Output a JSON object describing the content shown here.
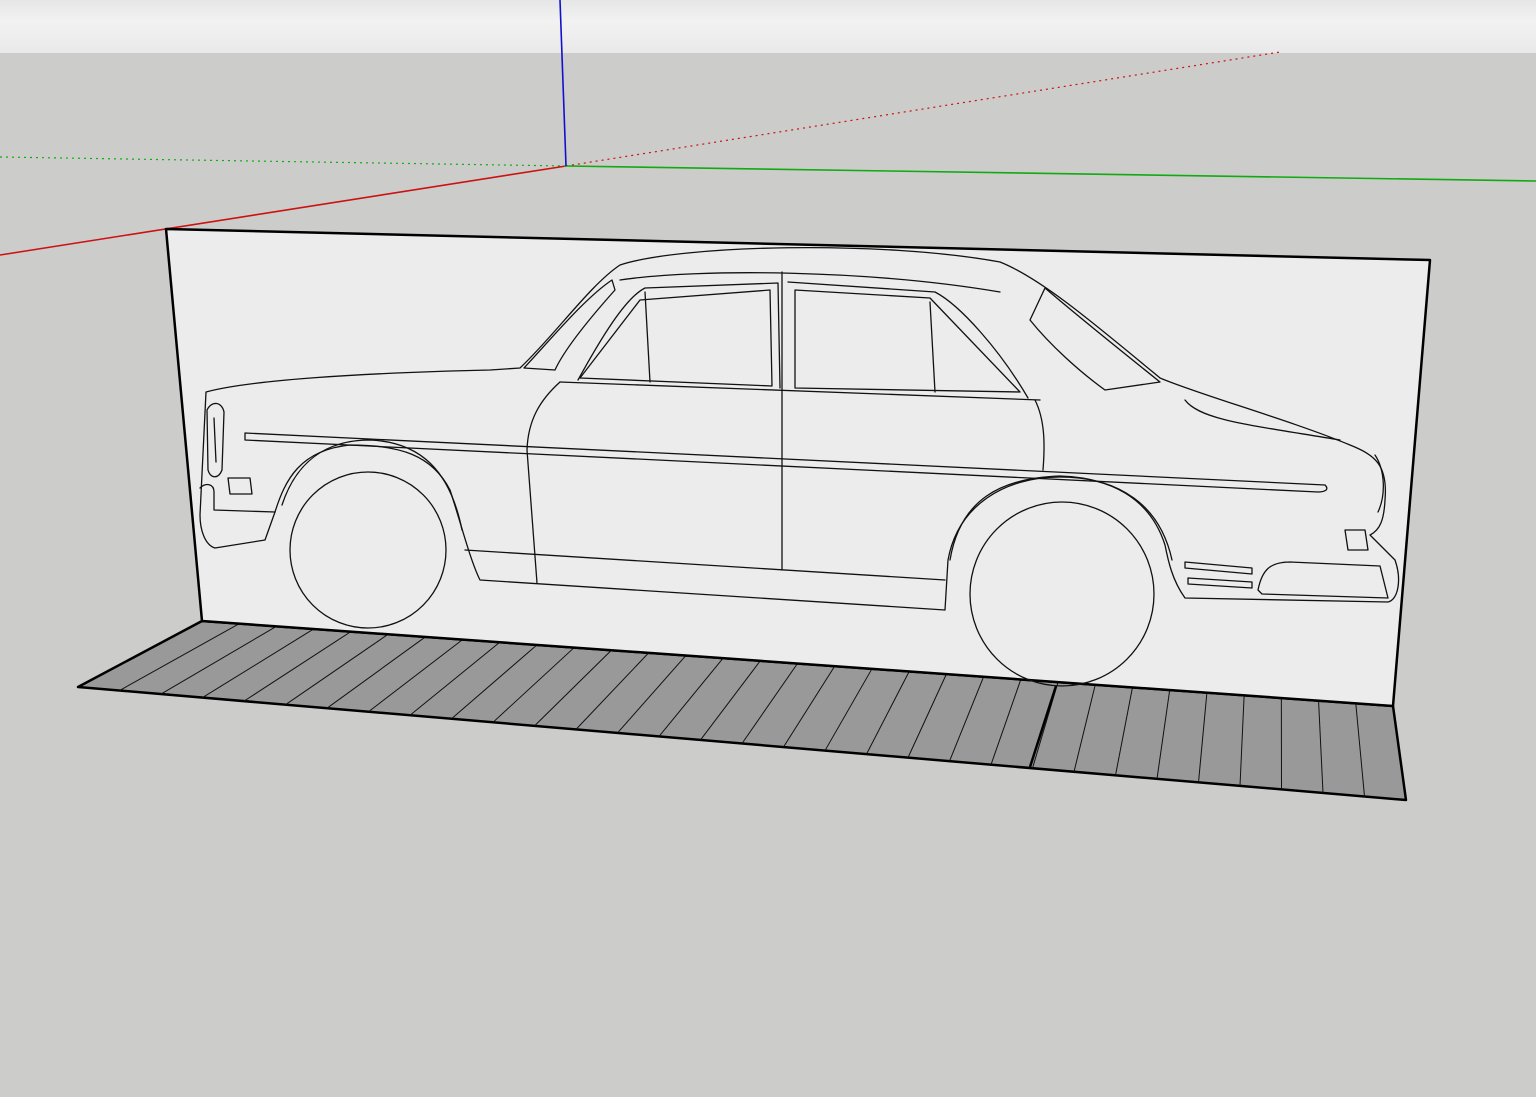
{
  "app": {
    "name": ""
  },
  "viewport": {
    "sky_color": "#eeeeee",
    "ground_color": "#cccccb",
    "axes": {
      "red": "#cc1111",
      "green": "#11aa11",
      "blue": "#1111cc"
    }
  },
  "model": {
    "panel": {
      "face_color": "#ececec",
      "edge_color": "#000000"
    },
    "base_plate": {
      "face_color": "#999999",
      "edge_color": "#000000"
    },
    "car_outline": {
      "stroke_color": "#111111",
      "style": "side-view sedan line drawing"
    }
  }
}
